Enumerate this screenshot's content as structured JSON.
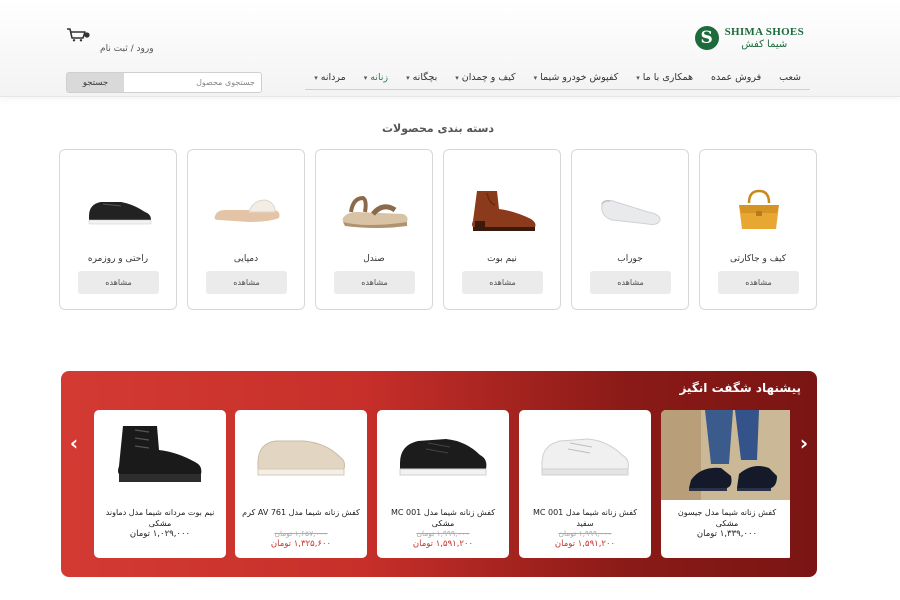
{
  "brand": {
    "name_en": "SHIMA SHOES",
    "name_fa": "شیما کفش",
    "accent": "#1d6a3c"
  },
  "header": {
    "login": "ورود",
    "separator": "/",
    "register": "ثبت نام",
    "cart_icon": "cart-icon"
  },
  "nav": {
    "items": [
      {
        "label": "مردانه",
        "dropdown": true
      },
      {
        "label": "زنانه",
        "dropdown": true,
        "active": true
      },
      {
        "label": "بچگانه",
        "dropdown": true
      },
      {
        "label": "کیف و چمدان",
        "dropdown": true
      },
      {
        "label": "کفپوش خودرو شیما",
        "dropdown": true
      },
      {
        "label": "همکاری با ما",
        "dropdown": true
      },
      {
        "label": "فروش عمده",
        "dropdown": false
      },
      {
        "label": "شعب",
        "dropdown": false
      }
    ]
  },
  "search": {
    "placeholder": "جستجوی محصول",
    "button": "جستجو"
  },
  "categories": {
    "title": "دسته بندی محصولات",
    "items": [
      {
        "name": "کیف و جاکارتی",
        "button": "مشاهده",
        "icon": "handbag-icon"
      },
      {
        "name": "جوراب",
        "button": "مشاهده",
        "icon": "sock-icon"
      },
      {
        "name": "نیم بوت",
        "button": "مشاهده",
        "icon": "boot-icon"
      },
      {
        "name": "صندل",
        "button": "مشاهده",
        "icon": "sandal-icon"
      },
      {
        "name": "دمپایی",
        "button": "مشاهده",
        "icon": "slipper-icon"
      },
      {
        "name": "راحتی و روزمره",
        "button": "مشاهده",
        "icon": "sneaker-icon"
      }
    ]
  },
  "offers": {
    "title": "پیشنهاد شگفت انگیز",
    "colors": {
      "start": "#d33a33",
      "end": "#7a1513"
    },
    "products": [
      {
        "name": "کفش زنانه شیما مدل جیسون مشکی",
        "old_price": "",
        "price": "۱,۳۳۹,۰۰۰ تومان"
      },
      {
        "name": "کفش زنانه شیما مدل MC 001 سفید",
        "old_price": "۱,۹۹۹,۰۰۰ تومان",
        "price": "۱,۵۹۱,۲۰۰ تومان"
      },
      {
        "name": "کفش زنانه شیما مدل MC 001 مشکی",
        "old_price": "۱,۹۹۹,۰۰۰ تومان",
        "price": "۱,۵۹۱,۲۰۰ تومان"
      },
      {
        "name": "کفش زنانه شیما مدل AV 761 کرم",
        "old_price": "۱,۶۵۷,۰۰۰ تومان",
        "price": "۱,۳۲۵,۶۰۰ تومان"
      },
      {
        "name": "نیم بوت مردانه شیما مدل دماوند مشکی",
        "old_price": "",
        "price": "۱,۰۲۹,۰۰۰ تومان"
      }
    ]
  }
}
